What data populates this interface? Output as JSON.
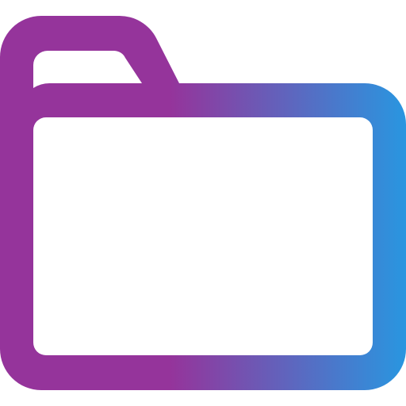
{
  "icon": {
    "name": "folder-icon",
    "style": "outline",
    "colors": {
      "gradient_start": "#95349B",
      "gradient_mid": "#95349B",
      "gradient_end": "#2996E0",
      "background": "#FFFFFF"
    }
  }
}
